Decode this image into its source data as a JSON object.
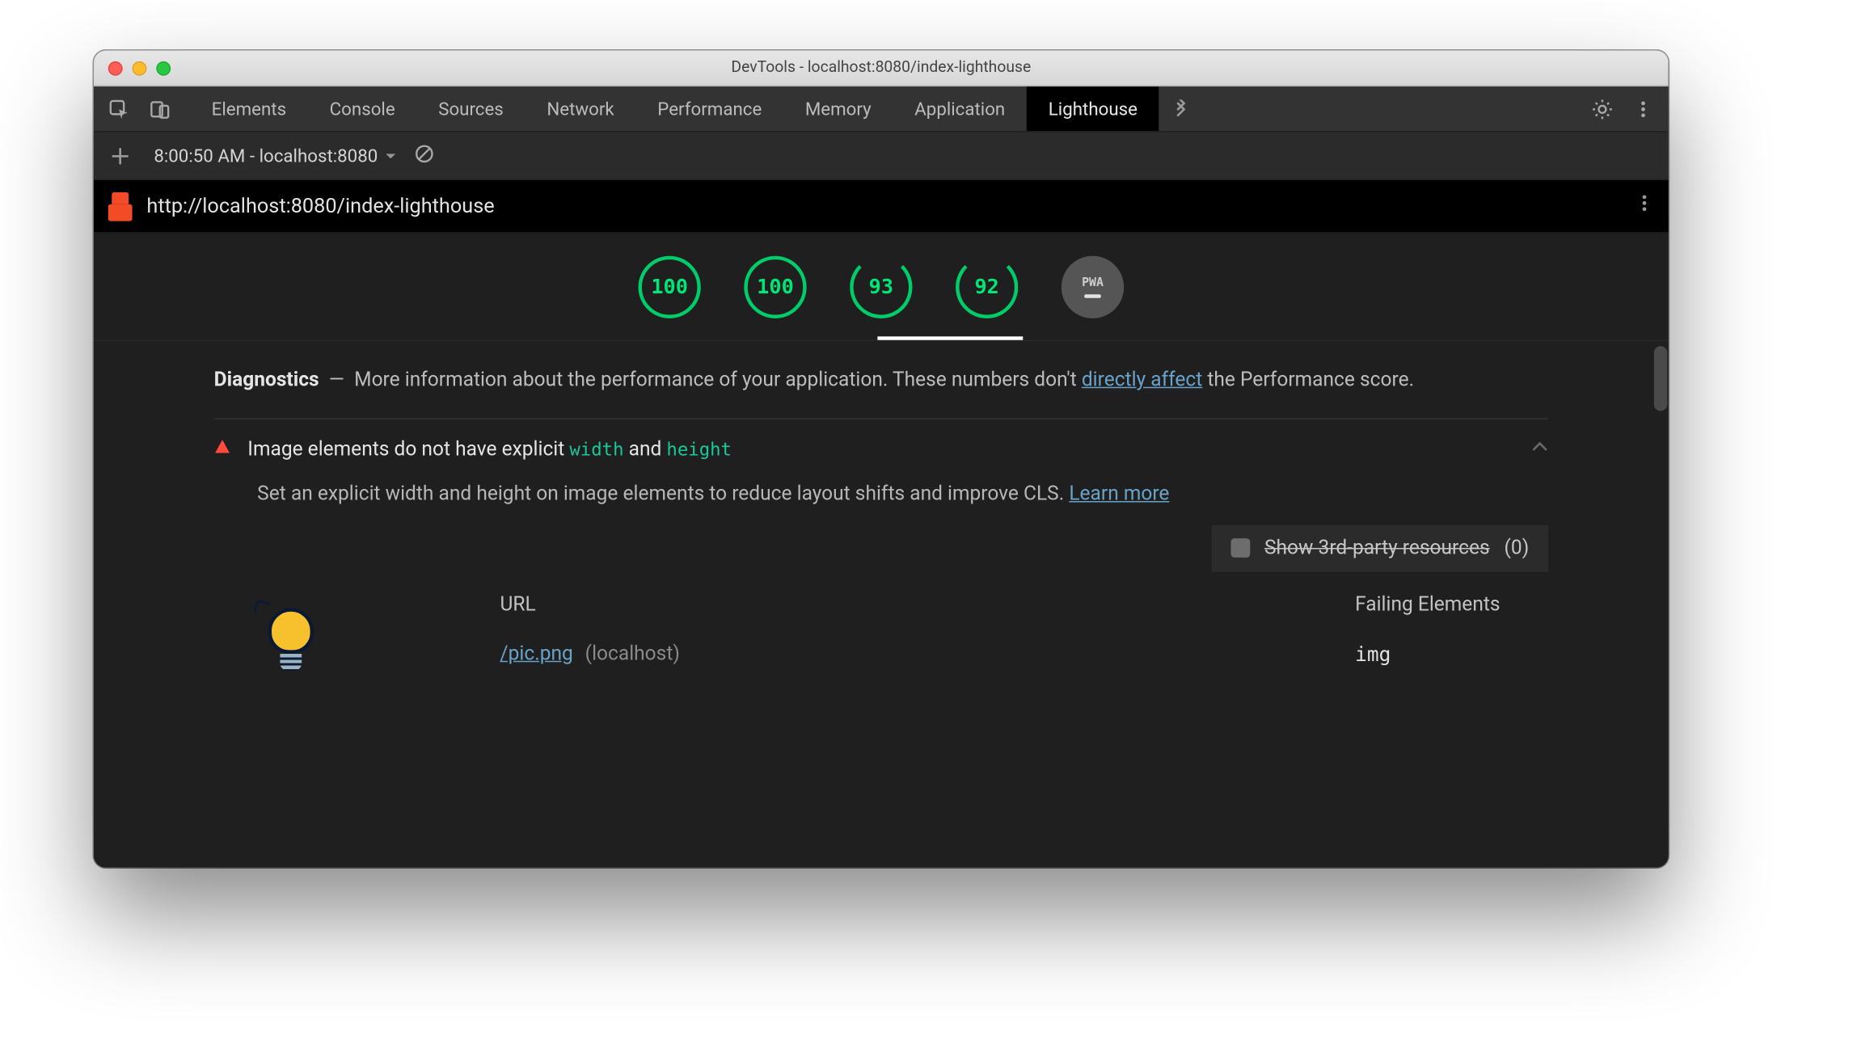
{
  "window": {
    "title": "DevTools - localhost:8080/index-lighthouse"
  },
  "tabs": {
    "items": [
      "Elements",
      "Console",
      "Sources",
      "Network",
      "Performance",
      "Memory",
      "Application",
      "Lighthouse"
    ],
    "active_index": 7
  },
  "subbar": {
    "run_label": "8:00:50 AM - localhost:8080"
  },
  "url_row": {
    "url": "http://localhost:8080/index-lighthouse"
  },
  "scores": {
    "gauges": [
      {
        "value": 100,
        "kind": "full"
      },
      {
        "value": 100,
        "kind": "full"
      },
      {
        "value": 93,
        "kind": "partial"
      },
      {
        "value": 92,
        "kind": "partial"
      }
    ],
    "pwa_label": "PWA",
    "active_under_index": 0
  },
  "diagnostics": {
    "heading": "Diagnostics",
    "separator": "—",
    "desc_before_link": "More information about the performance of your application. These numbers don't ",
    "link_text": "directly affect",
    "desc_after_link": " the Performance score."
  },
  "audit": {
    "title_prefix": "Image elements do not have explicit ",
    "code1": "width",
    "mid": " and ",
    "code2": "height",
    "description": "Set an explicit width and height on image elements to reduce layout shifts and improve CLS. ",
    "learn_more": "Learn more",
    "thirdparty_label": "Show 3rd-party resources",
    "thirdparty_count": "(0)",
    "columns": {
      "url": "URL",
      "failing": "Failing Elements"
    },
    "row": {
      "path": "/pic.png",
      "host": "(localhost)",
      "failing": "img"
    }
  }
}
